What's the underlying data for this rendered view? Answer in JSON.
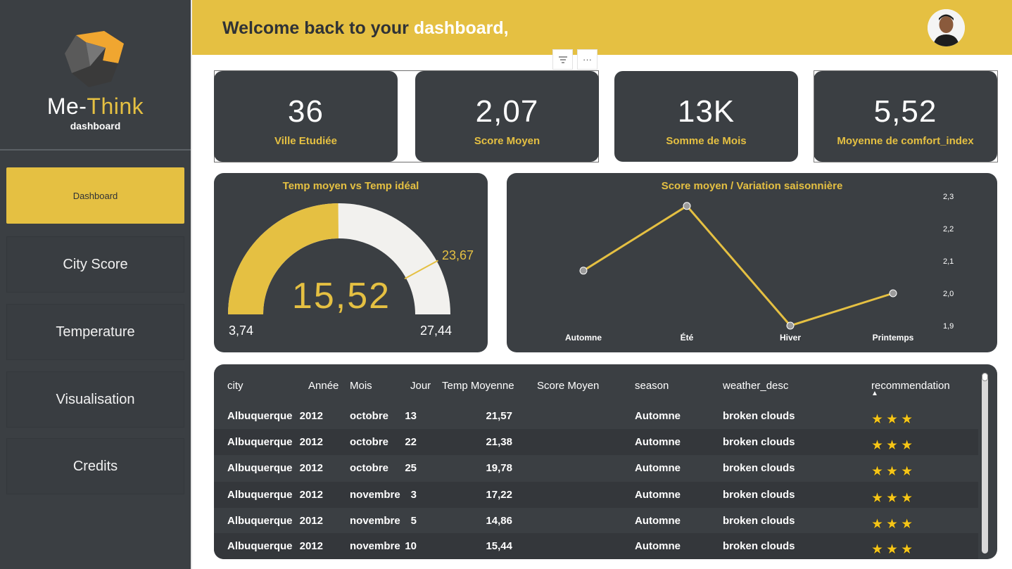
{
  "brand": {
    "name_part1": "Me-",
    "name_part2": "Think",
    "subtitle": "dashboard"
  },
  "nav": [
    {
      "label": "Dashboard",
      "active": true
    },
    {
      "label": "City Score"
    },
    {
      "label": "Temperature"
    },
    {
      "label": "Visualisation"
    },
    {
      "label": "Credits"
    }
  ],
  "header": {
    "welcome_prefix": "Welcome back to your ",
    "welcome_highlight": "dashboard,"
  },
  "toolbar": {
    "filter_icon": "filter-icon",
    "more_icon": "more-options-icon",
    "more_glyph": "···"
  },
  "kpis": [
    {
      "value": "36",
      "label": "Ville Etudiée"
    },
    {
      "value": "2,07",
      "label": "Score Moyen"
    },
    {
      "value": "13K",
      "label": "Somme de Mois"
    },
    {
      "value": "5,52",
      "label": "Moyenne de comfort_index"
    }
  ],
  "gauge": {
    "title": "Temp moyen vs Temp idéal",
    "value": "15,52",
    "min": "3,74",
    "max": "27,44",
    "target": "23,67",
    "value_num": 15.52,
    "min_num": 3.74,
    "max_num": 27.44,
    "target_num": 23.67,
    "fill_color": "#e5c042",
    "track_color": "#f2f1ee"
  },
  "chart_data": {
    "type": "line",
    "title": "Score moyen / Variation saisonnière",
    "categories": [
      "Automne",
      "Été",
      "Hiver",
      "Printemps"
    ],
    "values": [
      2.07,
      2.27,
      1.9,
      2.0
    ],
    "ylim": [
      1.9,
      2.3
    ],
    "yticks": [
      "2,3",
      "2,2",
      "2,1",
      "2,0",
      "1,9"
    ],
    "ytick_values": [
      2.3,
      2.2,
      2.1,
      2.0,
      1.9
    ],
    "line_color": "#e5c042",
    "marker_color": "#9b9b9b",
    "axis_position": "right",
    "grid": false
  },
  "table": {
    "columns": [
      "city",
      "Année",
      "Mois",
      "Jour",
      "Temp Moyenne",
      "Score Moyen",
      "season",
      "weather_desc",
      "recommendation"
    ],
    "sort_indicator": "▲",
    "rows": [
      [
        "Albuquerque",
        "2012",
        "octobre",
        "13",
        "21,57",
        "",
        "Automne",
        "broken clouds",
        "★★★"
      ],
      [
        "Albuquerque",
        "2012",
        "octobre",
        "22",
        "21,38",
        "",
        "Automne",
        "broken clouds",
        "★★★"
      ],
      [
        "Albuquerque",
        "2012",
        "octobre",
        "25",
        "19,78",
        "",
        "Automne",
        "broken clouds",
        "★★★"
      ],
      [
        "Albuquerque",
        "2012",
        "novembre",
        "3",
        "17,22",
        "",
        "Automne",
        "broken clouds",
        "★★★"
      ],
      [
        "Albuquerque",
        "2012",
        "novembre",
        "5",
        "14,86",
        "",
        "Automne",
        "broken clouds",
        "★★★"
      ],
      [
        "Albuquerque",
        "2012",
        "novembre",
        "10",
        "15,44",
        "",
        "Automne",
        "broken clouds",
        "★★★"
      ]
    ]
  },
  "colors": {
    "accent": "#e5c042",
    "panel": "#3b3f43",
    "sidebar": "#3b3f43"
  }
}
